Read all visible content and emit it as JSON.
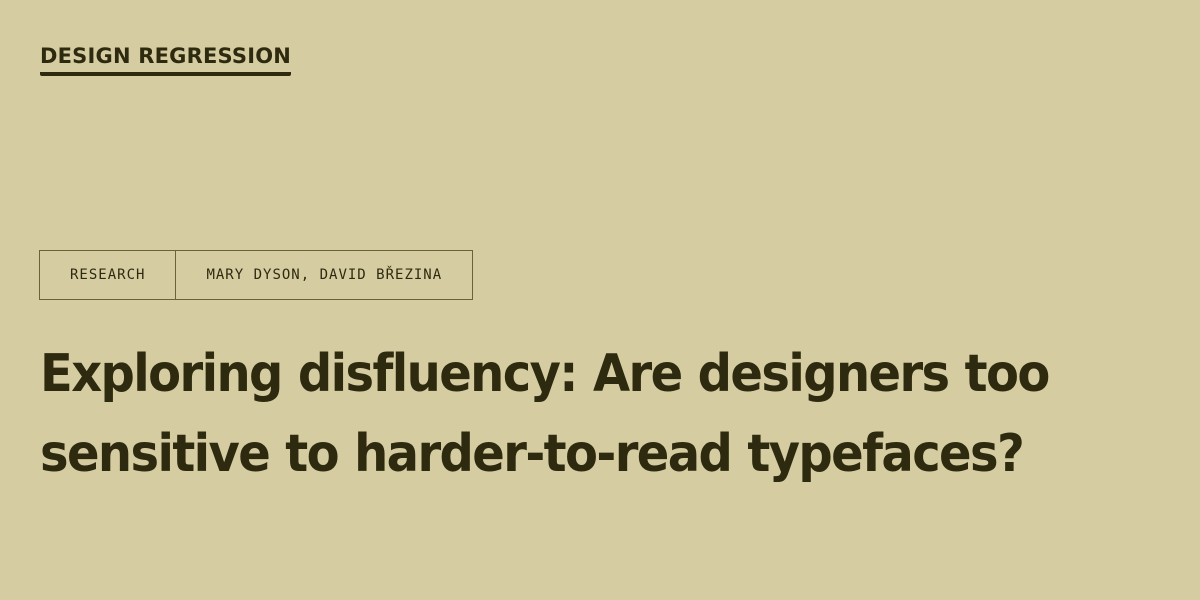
{
  "header": {
    "brand": "DESIGN REGRESSION"
  },
  "meta": {
    "category": "RESEARCH",
    "authors": "MARY DYSON, DAVID BŘEZINA"
  },
  "article": {
    "title_line_1": "Exploring disfluency: Are designers too",
    "title_line_2": "sensitive to harder-to-read typefaces?"
  },
  "colors": {
    "background": "#d6cca2",
    "text": "#2e2a0f",
    "border": "#6b6338"
  }
}
